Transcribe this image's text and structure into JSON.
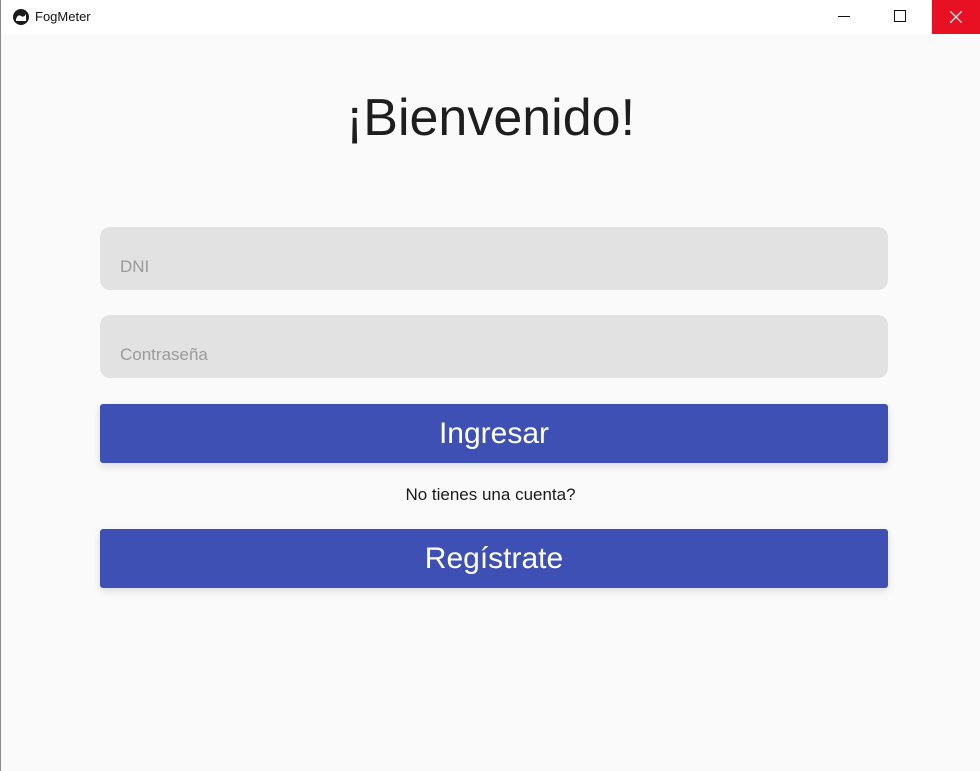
{
  "window": {
    "title": "FogMeter",
    "controls": {
      "minimize_icon": "minimize-icon",
      "maximize_icon": "maximize-icon",
      "close_icon": "close-icon",
      "close_hover_color": "#e81123"
    }
  },
  "login": {
    "heading": "¡Bienvenido!",
    "dni_placeholder": "DNI",
    "password_placeholder": "Contraseña",
    "login_button": "Ingresar",
    "no_account_text": "No tienes una cuenta?",
    "register_button": "Regístrate"
  },
  "colors": {
    "primary": "#3e50b4",
    "field_background": "#e2e2e2",
    "background": "#fafafa"
  }
}
